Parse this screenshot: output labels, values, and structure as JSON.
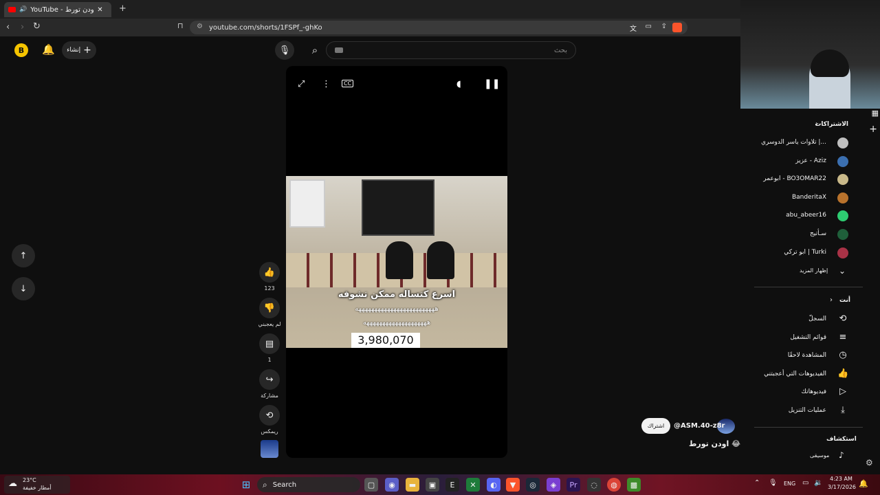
{
  "browser": {
    "tab_title": "YouTube - اودن تورط 😂",
    "new_tab": "+",
    "url": "youtube.com/shorts/1FSPf_-ghKo"
  },
  "header": {
    "search_placeholder": "بحث",
    "create_label": "إنشاء"
  },
  "video": {
    "caption_line1": "اسرع كتساله ممكن تشوفه",
    "caption_line2": "هههههههههههههههههههههههههه",
    "caption_line3": "ههههههههههههههههههههه",
    "counter": "3,980,070",
    "channel": "@ASM.40-z8r",
    "subscribe": "اشتراك",
    "title": "اودن تورط 😂"
  },
  "actions": {
    "likes": "123",
    "dislike": "لم يعجبني",
    "comments": "1",
    "share": "مشاركة",
    "remix": "ريمكس"
  },
  "sidebar": {
    "subscriptions_title": "الاشتراكات",
    "subscriptions": [
      {
        "label": "تلاوات ياسر الدوسري |...",
        "color": "#bfbfbf"
      },
      {
        "label": "عزيز - Aziz",
        "color": "#3b6fb0"
      },
      {
        "label": "ابوعمر - BO3OMAR22",
        "color": "#c9b98a"
      },
      {
        "label": "BanderitaX",
        "color": "#b8722c"
      },
      {
        "label": "abu_abeer16",
        "color": "#2ecc71"
      },
      {
        "label": "سـأتيج",
        "color": "#1f5f3a"
      },
      {
        "label": "ابو تركي | Turki",
        "color": "#a83246"
      }
    ],
    "show_more": "إظهار المزيد",
    "you_title": "أنت",
    "you_items": [
      "السجلّ",
      "قوائم التشغيل",
      "المشاهدة لاحقًا",
      "الفيديوهات التي أعجبتني",
      "فيديوهاتك",
      "عمليات التنزيل"
    ],
    "explore_title": "استكشاف",
    "explore_items": [
      "موسيقى"
    ]
  },
  "taskbar": {
    "weather_temp": "23°C",
    "weather_desc": "أمطار خفيفة",
    "search_label": "Search",
    "language": "ENG",
    "time": "4:23 AM",
    "date": "3/17/2026"
  },
  "colors": {
    "accent": "#ff0000",
    "brave": "#fb542b"
  }
}
